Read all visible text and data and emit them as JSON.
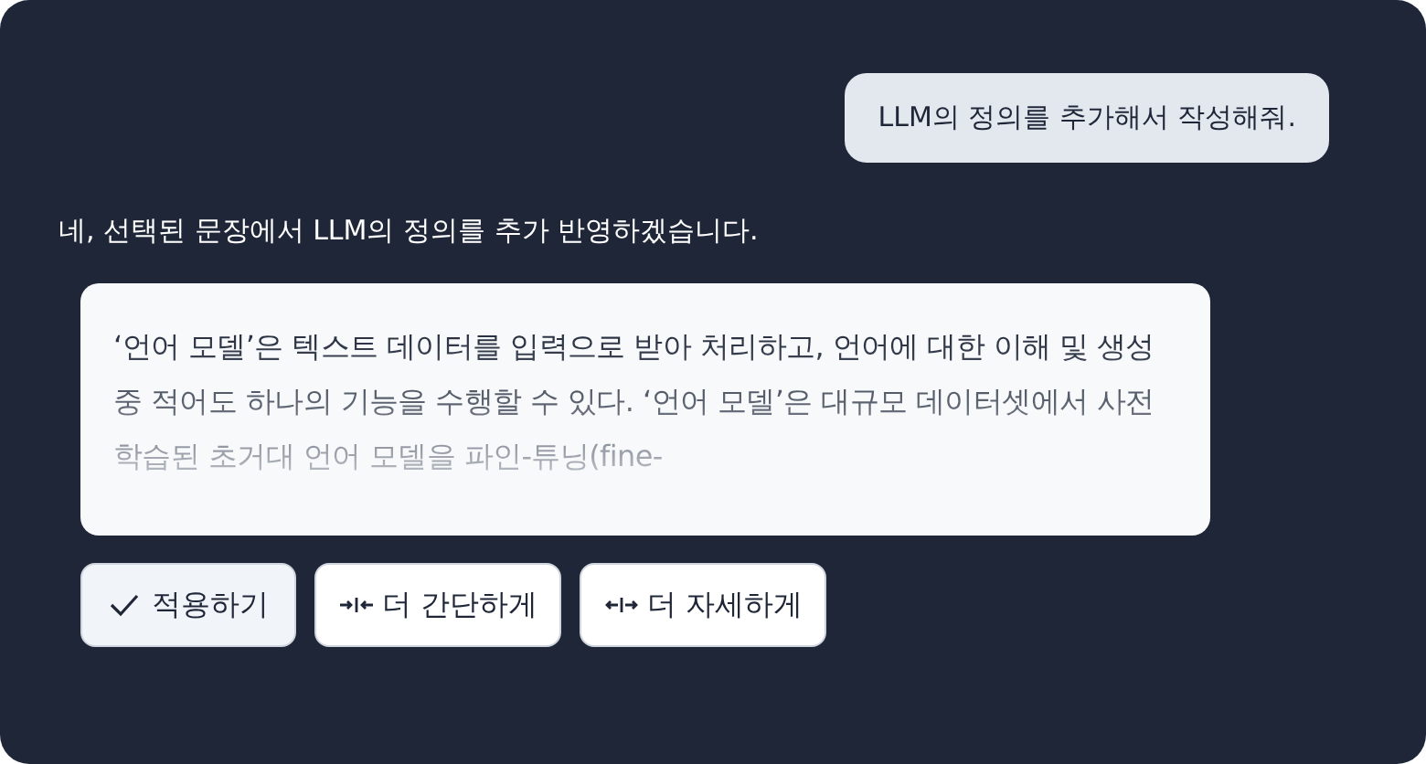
{
  "user_message": "LLM의 정의를 추가해서 작성해줘.",
  "assistant_message": "네, 선택된 문장에서 LLM의 정의를 추가 반영하겠습니다.",
  "suggestion": "‘언어 모델’은 텍스트 데이터를 입력으로 받아 처리하고, 언어에 대한 이해 및 생성 중 적어도 하나의 기능을 수행할 수 있다. ‘언어 모델’은 대규모 데이터셋에서 사전 학습된 초거대 언어 모델을 파인-튜닝(fine-",
  "actions": [
    {
      "kind": "apply",
      "label": "적용하기"
    },
    {
      "kind": "shorter",
      "label": "더 간단하게"
    },
    {
      "kind": "longer",
      "label": "더 자세하게"
    }
  ]
}
